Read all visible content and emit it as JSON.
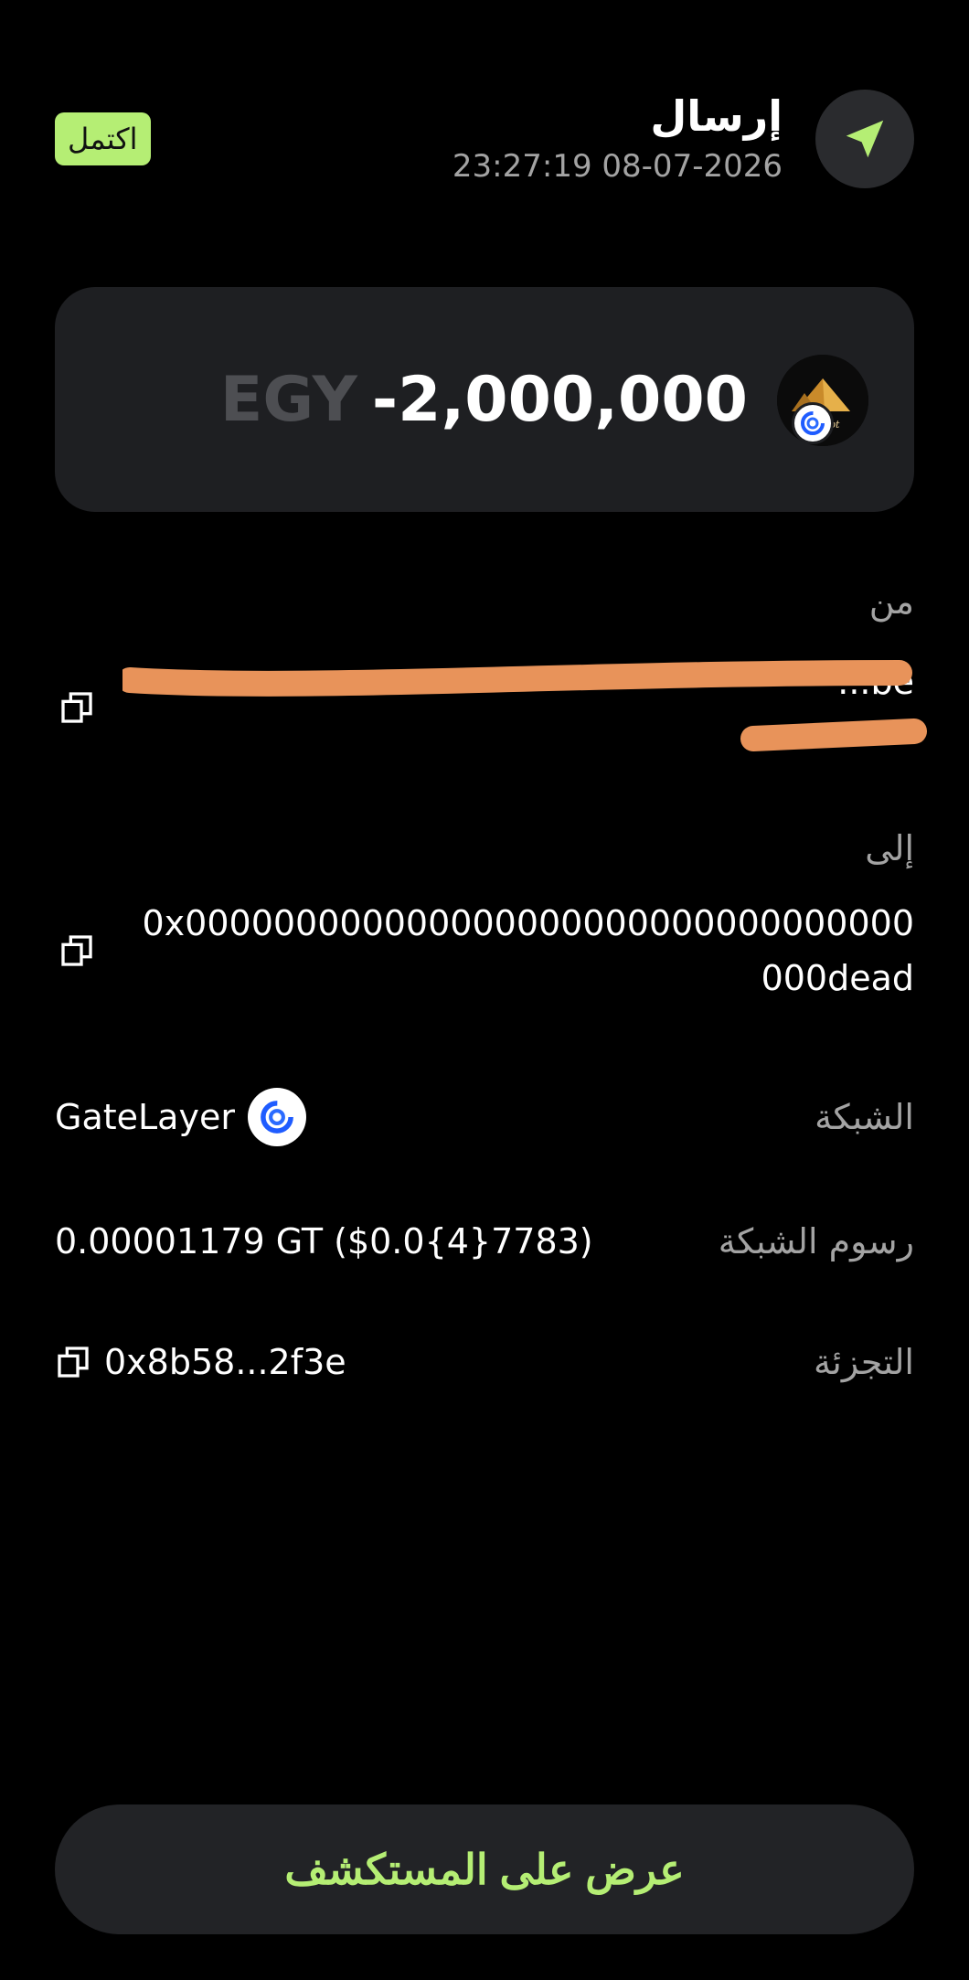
{
  "header": {
    "title": "إرسال",
    "timestamp": "23:27:19 08-07-2026",
    "status": "اكتمل",
    "icon": "send-arrow-icon"
  },
  "amount": {
    "value": "-2,000,000",
    "symbol": "EGY",
    "token_logo_text": "Egypt"
  },
  "from": {
    "label": "من",
    "address_visible": "...be",
    "copy_icon": "copy-icon"
  },
  "to": {
    "label": "إلى",
    "address": "0x000000000000000000000000000000000000dead",
    "copy_icon": "copy-icon"
  },
  "details": {
    "network_label": "الشبكة",
    "network_value": "GateLayer",
    "fee_label": "رسوم الشبكة",
    "fee_value": "0.00001179 GT ($0.0{4}7783)",
    "hash_label": "التجزئة",
    "hash_value": "0x8b58...2f3e"
  },
  "button": {
    "label": "عرض على المستكشف"
  },
  "colors": {
    "accent": "#b5ee74",
    "background": "#000000",
    "card": "#1e1f22",
    "muted": "#a3a3a3",
    "redaction": "#e8935a"
  }
}
